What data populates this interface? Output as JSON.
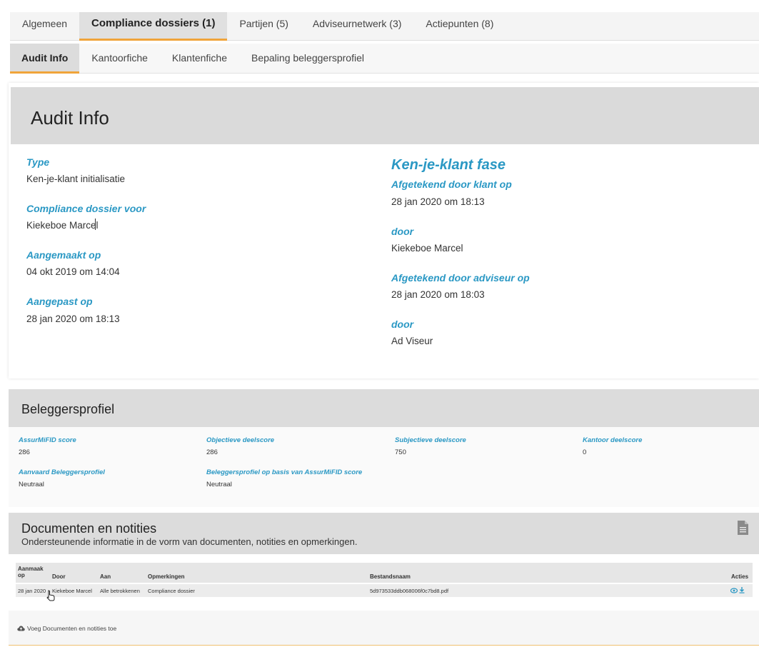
{
  "tabs_main": [
    {
      "label": "Algemeen",
      "active": false
    },
    {
      "label": "Compliance dossiers (1)",
      "active": true
    },
    {
      "label": "Partijen (5)",
      "active": false
    },
    {
      "label": "Adviseurnetwerk (3)",
      "active": false
    },
    {
      "label": "Actiepunten (8)",
      "active": false
    }
  ],
  "tabs_sub": [
    {
      "label": "Audit Info",
      "active": true
    },
    {
      "label": "Kantoorfiche",
      "active": false
    },
    {
      "label": "Klantenfiche",
      "active": false
    },
    {
      "label": "Bepaling beleggersprofiel",
      "active": false
    }
  ],
  "audit": {
    "title": "Audit Info",
    "type_label": "Type",
    "type_value": "Ken-je-klant initialisatie",
    "dossier_label": "Compliance dossier voor",
    "dossier_value": "Kiekeboe Marcel",
    "created_label": "Aangemaakt op",
    "created_value": "04 okt 2019 om 14:04",
    "modified_label": "Aangepast op",
    "modified_value": "28 jan 2020 om 18:13",
    "phase_title": "Ken-je-klant fase",
    "signed_client_label": "Afgetekend door klant op",
    "signed_client_value": "28 jan 2020 om 18:13",
    "by_label_1": "door",
    "by_value_1": "Kiekeboe Marcel",
    "signed_advisor_label": "Afgetekend door adviseur op",
    "signed_advisor_value": "28 jan 2020 om 18:03",
    "by_label_2": "door",
    "by_value_2": "Ad Viseur"
  },
  "belegger": {
    "title": "Beleggersprofiel",
    "assurmifid_label": "AssurMiFID score",
    "assurmifid_value": "286",
    "objective_label": "Objectieve deelscore",
    "objective_value": "286",
    "subjective_label": "Subjectieve deelscore",
    "subjective_value": "750",
    "office_label": "Kantoor deelscore",
    "office_value": "0",
    "accepted_label": "Aanvaard Beleggersprofiel",
    "accepted_value": "Neutraal",
    "based_label": "Beleggersprofiel op basis van AssurMiFID score",
    "based_value": "Neutraal"
  },
  "docs": {
    "title": "Documenten en notities",
    "subtitle": "Ondersteunende informatie in de vorm van documenten, notities en opmerkingen.",
    "headers": {
      "created_line1": "Aanmaak",
      "created_line2": "op",
      "by": "Door",
      "to": "Aan",
      "remarks": "Opmerkingen",
      "filename": "Bestandsnaam",
      "actions": "Acties"
    },
    "rows": [
      {
        "created": "28 jan 2020",
        "by": "Kiekeboe Marcel",
        "to": "Alle betrokkenen",
        "remarks": "Compliance dossier",
        "filename": "5d973533ddb068006f0c7bd8.pdf"
      }
    ],
    "add_label": "Voeg Documenten en notities toe"
  },
  "colors": {
    "accent_blue": "#2a98c4",
    "accent_orange": "#f0a43a"
  }
}
